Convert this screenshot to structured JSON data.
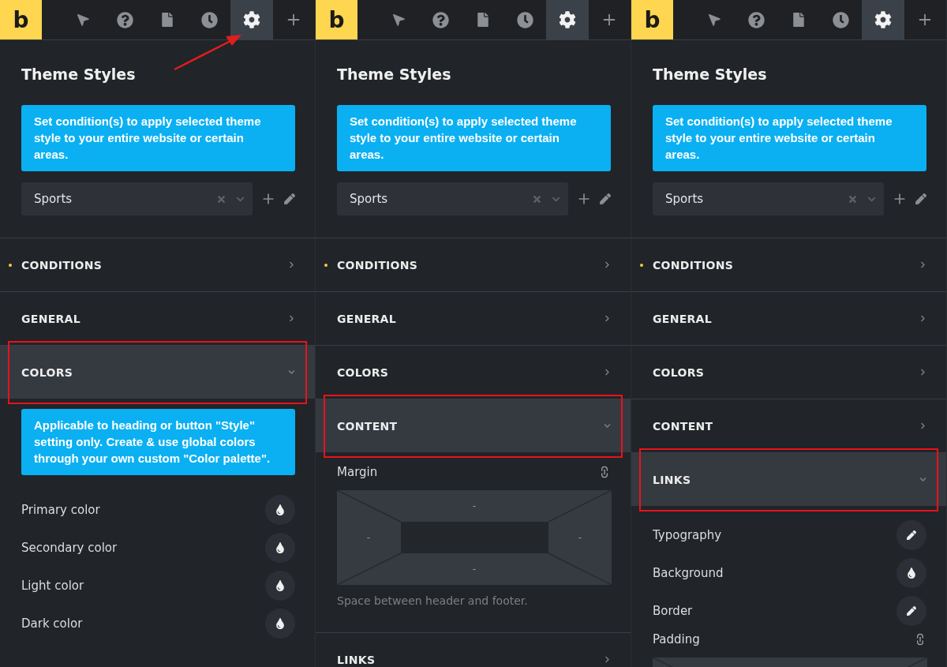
{
  "panels": [
    {
      "toolbar": {
        "logo": "b",
        "tools": [
          {
            "kind": "pointer",
            "selected": false
          },
          {
            "kind": "help",
            "selected": false
          },
          {
            "kind": "page",
            "selected": false
          },
          {
            "kind": "history",
            "selected": false
          },
          {
            "kind": "settings",
            "selected": true
          },
          {
            "kind": "add",
            "selected": false
          }
        ]
      },
      "arrow": true,
      "title": "Theme Styles",
      "notice": "Set condition(s) to apply selected theme style to your entire website or certain areas.",
      "select": {
        "value": "Sports"
      },
      "sections": [
        {
          "label": "CONDITIONS",
          "dot": true,
          "expanded": false,
          "highlighted": false
        },
        {
          "label": "GENERAL",
          "dot": false,
          "expanded": false,
          "highlighted": false
        },
        {
          "label": "COLORS",
          "dot": false,
          "expanded": true,
          "highlighted": true,
          "items": [
            {
              "kind": "notice",
              "text": "Applicable to heading or button \"Style\" setting only. Create & use global colors through your own custom \"Color palette\"."
            },
            {
              "kind": "color-row",
              "label": "Primary color"
            },
            {
              "kind": "color-row",
              "label": "Secondary color"
            },
            {
              "kind": "color-row",
              "label": "Light color"
            },
            {
              "kind": "color-row",
              "label": "Dark color"
            }
          ]
        }
      ]
    },
    {
      "toolbar": {
        "logo": "b",
        "tools": [
          {
            "kind": "pointer",
            "selected": false
          },
          {
            "kind": "help",
            "selected": false
          },
          {
            "kind": "page",
            "selected": false
          },
          {
            "kind": "history",
            "selected": false
          },
          {
            "kind": "settings",
            "selected": true
          },
          {
            "kind": "add",
            "selected": false
          }
        ]
      },
      "arrow": false,
      "title": "Theme Styles",
      "notice": "Set condition(s) to apply selected theme style to your entire website or certain areas.",
      "select": {
        "value": "Sports"
      },
      "sections": [
        {
          "label": "CONDITIONS",
          "dot": true,
          "expanded": false,
          "highlighted": false
        },
        {
          "label": "GENERAL",
          "dot": false,
          "expanded": false,
          "highlighted": false
        },
        {
          "label": "COLORS",
          "dot": false,
          "expanded": false,
          "highlighted": false
        },
        {
          "label": "CONTENT",
          "dot": false,
          "expanded": true,
          "highlighted": true,
          "items": [
            {
              "kind": "spacing-label",
              "label": "Margin"
            },
            {
              "kind": "spacing-box",
              "values": [
                "-",
                "-",
                "-",
                "-"
              ]
            },
            {
              "kind": "hint",
              "text": "Space between header and footer."
            }
          ]
        },
        {
          "label": "LINKS",
          "dot": false,
          "expanded": false,
          "highlighted": false
        }
      ]
    },
    {
      "toolbar": {
        "logo": "b",
        "tools": [
          {
            "kind": "pointer",
            "selected": false
          },
          {
            "kind": "help",
            "selected": false
          },
          {
            "kind": "page",
            "selected": false
          },
          {
            "kind": "history",
            "selected": false
          },
          {
            "kind": "settings",
            "selected": true
          },
          {
            "kind": "add",
            "selected": false
          }
        ]
      },
      "arrow": false,
      "title": "Theme Styles",
      "notice": "Set condition(s) to apply selected theme style to your entire website or certain areas.",
      "select": {
        "value": "Sports"
      },
      "sections": [
        {
          "label": "CONDITIONS",
          "dot": true,
          "expanded": false,
          "highlighted": false
        },
        {
          "label": "GENERAL",
          "dot": false,
          "expanded": false,
          "highlighted": false
        },
        {
          "label": "COLORS",
          "dot": false,
          "expanded": false,
          "highlighted": false
        },
        {
          "label": "CONTENT",
          "dot": false,
          "expanded": false,
          "highlighted": false
        },
        {
          "label": "LINKS",
          "dot": false,
          "expanded": true,
          "highlighted": true,
          "items": [
            {
              "kind": "edit-row",
              "label": "Typography"
            },
            {
              "kind": "color-row",
              "label": "Background"
            },
            {
              "kind": "edit-row",
              "label": "Border"
            },
            {
              "kind": "spacing-label",
              "label": "Padding"
            },
            {
              "kind": "spacing-box"
            }
          ]
        }
      ]
    }
  ]
}
